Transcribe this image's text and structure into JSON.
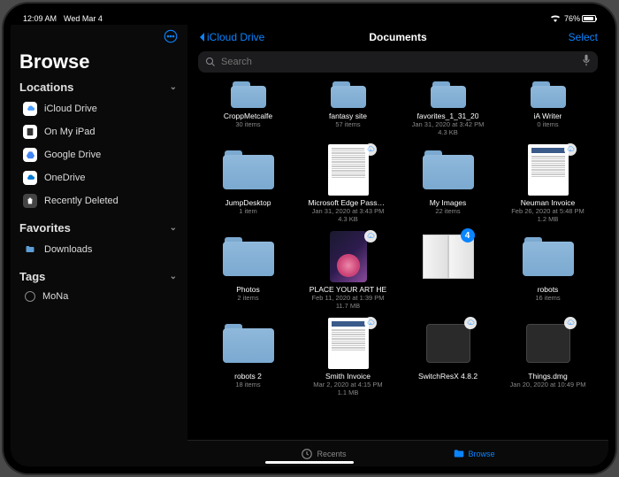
{
  "status": {
    "time": "12:09 AM",
    "date": "Wed Mar 4",
    "battery_pct": "76%"
  },
  "sidebar": {
    "title": "Browse",
    "sections": {
      "locations": {
        "title": "Locations",
        "items": [
          {
            "label": "iCloud Drive",
            "icon": "cloud"
          },
          {
            "label": "On My iPad",
            "icon": "ipad"
          },
          {
            "label": "Google Drive",
            "icon": "gdrive"
          },
          {
            "label": "OneDrive",
            "icon": "onedrive"
          },
          {
            "label": "Recently Deleted",
            "icon": "trash"
          }
        ]
      },
      "favorites": {
        "title": "Favorites",
        "items": [
          {
            "label": "Downloads",
            "icon": "folder"
          }
        ]
      },
      "tags": {
        "title": "Tags",
        "items": [
          {
            "label": "MoNa",
            "icon": "tag"
          }
        ]
      }
    }
  },
  "nav": {
    "back": "iCloud Drive",
    "title": "Documents",
    "select": "Select"
  },
  "search": {
    "placeholder": "Search"
  },
  "files": [
    {
      "name": "CroppMetcalfe",
      "meta": "30 items",
      "type": "folder-small"
    },
    {
      "name": "fantasy site",
      "meta": "57 items",
      "type": "folder-small"
    },
    {
      "name": "favorites_1_31_20",
      "meta": "Jan 31, 2020 at 3:42 PM",
      "meta2": "4.3 KB",
      "type": "folder-small"
    },
    {
      "name": "iA Writer",
      "meta": "0 items",
      "type": "folder-small"
    },
    {
      "name": "JumpDesktop",
      "meta": "1 item",
      "type": "folder"
    },
    {
      "name": "Microsoft Edge Passwords",
      "meta": "Jan 31, 2020 at 3:43 PM",
      "meta2": "4.3 KB",
      "type": "doc",
      "cloud": true
    },
    {
      "name": "My Images",
      "meta": "22 items",
      "type": "folder"
    },
    {
      "name": "Neuman Invoice",
      "meta": "Feb 26, 2020 at 5:48 PM",
      "meta2": "1.2 MB",
      "type": "invoice",
      "cloud": true
    },
    {
      "name": "Photos",
      "meta": "2 items",
      "type": "folder"
    },
    {
      "name": "PLACE YOUR ART HE",
      "meta": "Feb 11, 2020 at 1:39 PM",
      "meta2": "11.7 MB",
      "type": "photo",
      "cloud": true
    },
    {
      "name": "",
      "meta": "",
      "type": "book",
      "badge": "4"
    },
    {
      "name": "robots",
      "meta": "16 items",
      "type": "folder"
    },
    {
      "name": "robots 2",
      "meta": "18 items",
      "type": "folder"
    },
    {
      "name": "Smith Invoice",
      "meta": "Mar 2, 2020 at 4:15 PM",
      "meta2": "1.1 MB",
      "type": "invoice",
      "cloud": true
    },
    {
      "name": "SwitchResX 4.8.2",
      "meta": "",
      "type": "dmg",
      "cloud": true
    },
    {
      "name": "Things.dmg",
      "meta": "Jan 20, 2020 at 10:49 PM",
      "type": "dmg",
      "cloud": true
    }
  ],
  "tabs": {
    "recents": "Recents",
    "browse": "Browse"
  }
}
